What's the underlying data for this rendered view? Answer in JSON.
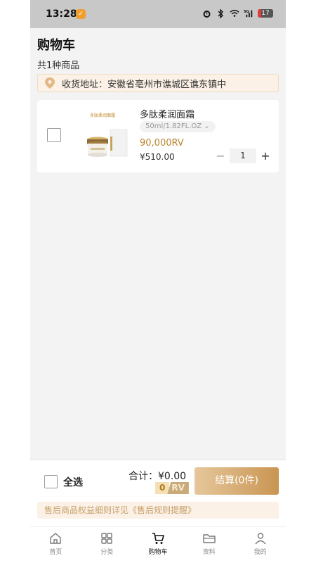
{
  "status_bar": {
    "time": "13:28",
    "signal": "5G",
    "battery": "17"
  },
  "header": {
    "title": "购物车",
    "item_count": "共1种商品"
  },
  "address": {
    "label": "收货地址：安徽省亳州市谯城区谯东镇中"
  },
  "cart_items": [
    {
      "thumbnail_text": "多肽柔润面霜",
      "name": "多肽柔润面霜",
      "variant": "50ml/1.82FL.OZ",
      "price_rv": "90,000RV",
      "price_cny": "¥510.00",
      "quantity": "1",
      "minus": "−",
      "plus": "+"
    }
  ],
  "footer": {
    "select_all": "全选",
    "total": "合计：¥0.00",
    "rv_amount": "0",
    "rv_unit": "RV",
    "checkout": "结算(0件)",
    "notice": "售后商品权益细则详见《售后规则提醒》"
  },
  "tabs": [
    {
      "label": "首页",
      "icon": "home-icon"
    },
    {
      "label": "分类",
      "icon": "grid-icon"
    },
    {
      "label": "购物车",
      "icon": "cart-icon",
      "active": true
    },
    {
      "label": "资料",
      "icon": "folder-icon"
    },
    {
      "label": "我的",
      "icon": "user-icon"
    }
  ],
  "colors": {
    "accent": "#c99552",
    "price": "#b8832e",
    "notice_bg": "#fbf1e6"
  }
}
